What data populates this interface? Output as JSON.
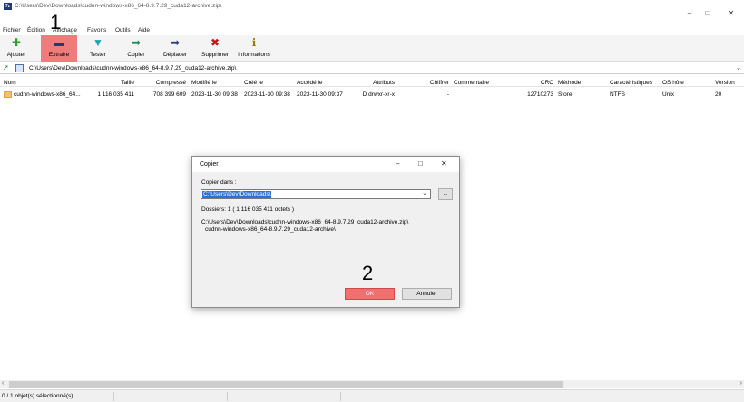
{
  "window": {
    "title": "C:\\Users\\Dev\\Downloads\\cudnn-windows-x86_64-8.9.7.29_cuda12-archive.zip\\",
    "app_icon": "7z",
    "controls": {
      "minimize": "–",
      "maximize": "□",
      "close": "✕"
    }
  },
  "menu": [
    "Fichier",
    "Édition",
    "Affichage",
    "Favoris",
    "Outils",
    "Aide"
  ],
  "toolbar": {
    "buttons": [
      {
        "label": "Ajouter",
        "icon": "plus-icon",
        "glyph": "✚",
        "color": "#2e9e2e"
      },
      {
        "label": "Extraire",
        "icon": "minus-icon",
        "glyph": "▬",
        "color": "#1e3a7a"
      },
      {
        "label": "Tester",
        "icon": "check-icon",
        "glyph": "▼",
        "color": "#1aa3b5"
      },
      {
        "label": "Copier",
        "icon": "copy-arrow-icon",
        "glyph": "➡",
        "color": "#1a8a5a"
      },
      {
        "label": "Déplacer",
        "icon": "move-arrow-icon",
        "glyph": "➡",
        "color": "#1e3a7a"
      },
      {
        "label": "Supprimer",
        "icon": "delete-x-icon",
        "glyph": "✖",
        "color": "#c01818"
      },
      {
        "label": "Informations",
        "icon": "info-icon",
        "glyph": "ℹ",
        "color": "#9a7a00"
      }
    ],
    "active_color": "#f07b7b"
  },
  "address": {
    "path": "C:\\Users\\Dev\\Downloads\\cudnn-windows-x86_64-8.9.7.29_cuda12-archive.zip\\"
  },
  "columns": [
    "Nom",
    "Taille",
    "Compressé",
    "Modifié le",
    "Créé le",
    "Accédé le",
    "Attributs",
    "Chiffrer",
    "Commentaire",
    "CRC",
    "Méthode",
    "Caractéristiques",
    "OS hôte",
    "Version"
  ],
  "rows": [
    {
      "name": "cudnn-windows-x86_64...",
      "size": "1 116 035 411",
      "packed": "708 399 609",
      "modified": "2023-11-30 09:38",
      "created": "2023-11-30 09:38",
      "accessed": "2023-11-30 09:37",
      "attributes": "D drwxr-xr-x",
      "encrypted": "-",
      "comment": "",
      "crc": "12710273",
      "method": "Store",
      "characteristics": "NTFS",
      "host_os": "Unix",
      "version": "20"
    }
  ],
  "status": {
    "selection": "0 / 1 objet(s) sélectionné(s)"
  },
  "dialog": {
    "title": "Copier",
    "controls": {
      "minimize": "–",
      "maximize": "□",
      "close": "✕"
    },
    "label": "Copier dans :",
    "destination": "C:\\Users\\Dev\\Downloads\\",
    "browse_label": "...",
    "info": "Dossiers: 1    ( 1 116 035 411 octets )",
    "path_line1": "C:\\Users\\Dev\\Downloads\\cudnn-windows-x86_64-8.9.7.29_cuda12-archive.zip\\",
    "path_line2": "cudnn-windows-x86_64-8.9.7.29_cuda12-archive\\",
    "ok_label": "OK",
    "cancel_label": "Annuler",
    "ok_color": "#f07070"
  },
  "annotations": {
    "step1": "1",
    "step2": "2"
  }
}
